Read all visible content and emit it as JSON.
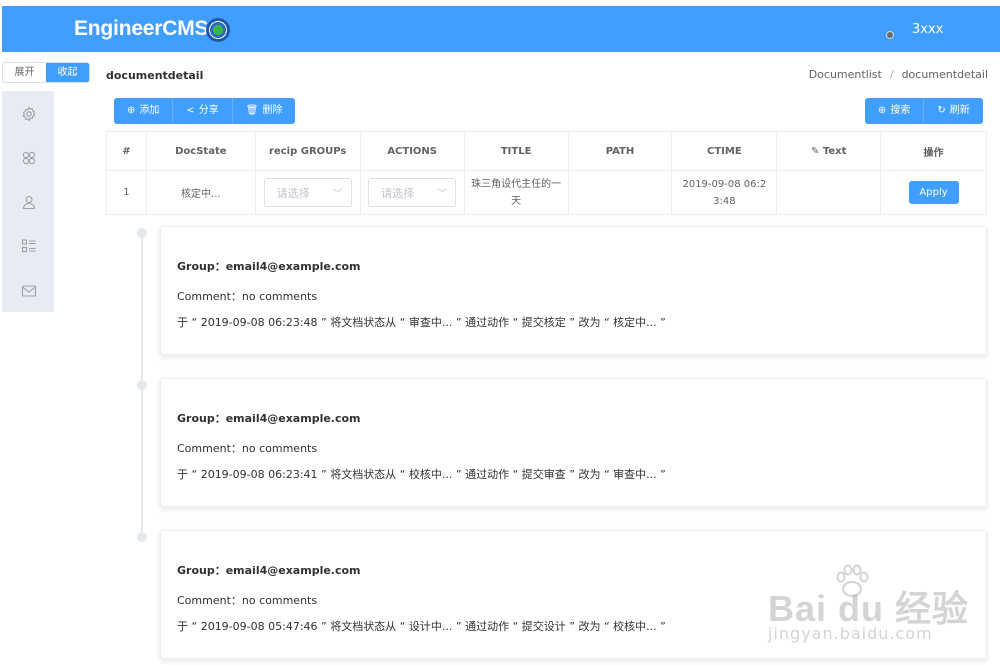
{
  "header": {
    "logo": "EngineerCMS",
    "user_name": "3xxx"
  },
  "toggle": {
    "expand": "展开",
    "collapse": "收起"
  },
  "sidebar": {
    "icons": [
      "gear-icon",
      "grid-icon",
      "user-icon",
      "list-icon",
      "mail-icon"
    ]
  },
  "page": {
    "title": "documentdetail",
    "breadcrumb": [
      "Documentlist",
      "/",
      "documentdetail"
    ]
  },
  "toolbar_left": [
    {
      "label": "添加",
      "icon": "plus-circle-icon"
    },
    {
      "label": "分享",
      "icon": "share-icon"
    },
    {
      "label": "删除",
      "icon": "trash-icon"
    }
  ],
  "toolbar_right": [
    {
      "label": "搜索",
      "icon": "plus-circle-icon"
    },
    {
      "label": "刷新",
      "icon": "refresh-icon"
    }
  ],
  "table": {
    "headers": [
      "#",
      "DocState",
      "recip GROUPs",
      "ACTIONS",
      "TITLE",
      "PATH",
      "CTIME",
      "Text",
      "操作"
    ],
    "row": {
      "index": "1",
      "docstate": "核定中...",
      "recip_placeholder": "请选择",
      "actions_placeholder": "请选择",
      "title": "珠三角设代主任的一天",
      "path": "",
      "ctime": "2019-09-08 06:23:48",
      "text": "",
      "apply_label": "Apply"
    }
  },
  "timeline": [
    {
      "group": "Group：email4@example.com",
      "comment": "Comment：no comments",
      "log": "于 “ 2019-09-08 06:23:48 ” 将文档状态从 “ 审查中... ” 通过动作 “ 提交核定 ” 改为 “ 核定中... ”"
    },
    {
      "group": "Group：email4@example.com",
      "comment": "Comment：no comments",
      "log": "于 “ 2019-09-08 06:23:41 ” 将文档状态从 “ 校核中... ” 通过动作 “ 提交审查 ” 改为 “ 审查中... ”"
    },
    {
      "group": "Group：email4@example.com",
      "comment": "Comment：no comments",
      "log": "于 “ 2019-09-08 05:47:46 ” 将文档状态从 “ 设计中... ” 通过动作 “ 提交设计 ” 改为 “ 校核中... ”"
    }
  ],
  "watermark": {
    "brand": "Bai du 经验",
    "url": "jingyan.baidu.com"
  },
  "colors": {
    "primary": "#409eff",
    "sidebar": "#e8ebf3"
  }
}
